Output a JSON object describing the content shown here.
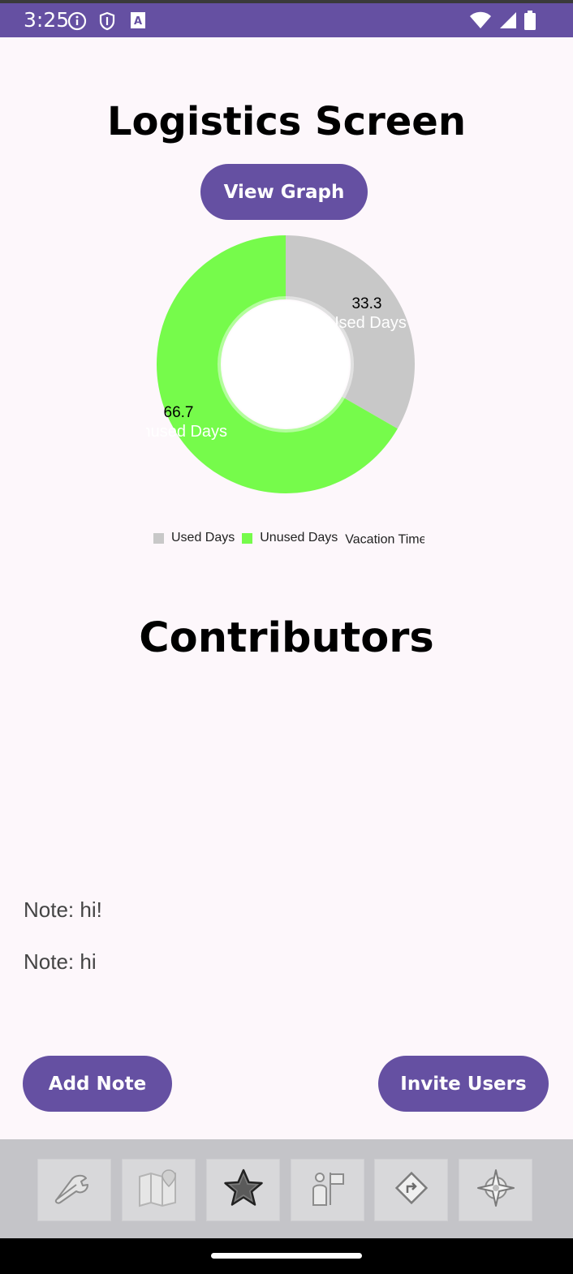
{
  "status": {
    "time": "3:25",
    "icons": [
      "info-icon",
      "shield-icon",
      "keyboard-a-icon",
      "wifi-icon",
      "signal-icon",
      "battery-icon"
    ]
  },
  "header": {
    "title": "Logistics Screen"
  },
  "actions": {
    "view_graph": "View Graph",
    "add_note": "Add Note",
    "invite_users": "Invite Users"
  },
  "chart_data": {
    "type": "pie",
    "donut": true,
    "title": "",
    "slices": [
      {
        "label": "Used Days",
        "value": 33.3,
        "color": "#c8c8c8"
      },
      {
        "label": "Unused Days",
        "value": 66.7,
        "color": "#76fb4b"
      }
    ],
    "value_labels": [
      "33.3",
      "66.7"
    ],
    "slice_labels": [
      "Used Days",
      "Unused Days"
    ],
    "legend": {
      "placement": "bottom",
      "items": [
        {
          "label": "Used Days",
          "color": "#c8c8c8"
        },
        {
          "label": "Unused Days",
          "color": "#76fb4b"
        }
      ],
      "description": "Vacation Time"
    }
  },
  "contributors": {
    "title": "Contributors"
  },
  "notes": [
    "Note: hi!",
    "Note: hi"
  ],
  "bottom_nav": [
    {
      "icon": "wrench-icon"
    },
    {
      "icon": "map-icon"
    },
    {
      "icon": "star-icon"
    },
    {
      "icon": "person-flag-icon"
    },
    {
      "icon": "directions-sign-icon"
    },
    {
      "icon": "compass-icon"
    }
  ]
}
